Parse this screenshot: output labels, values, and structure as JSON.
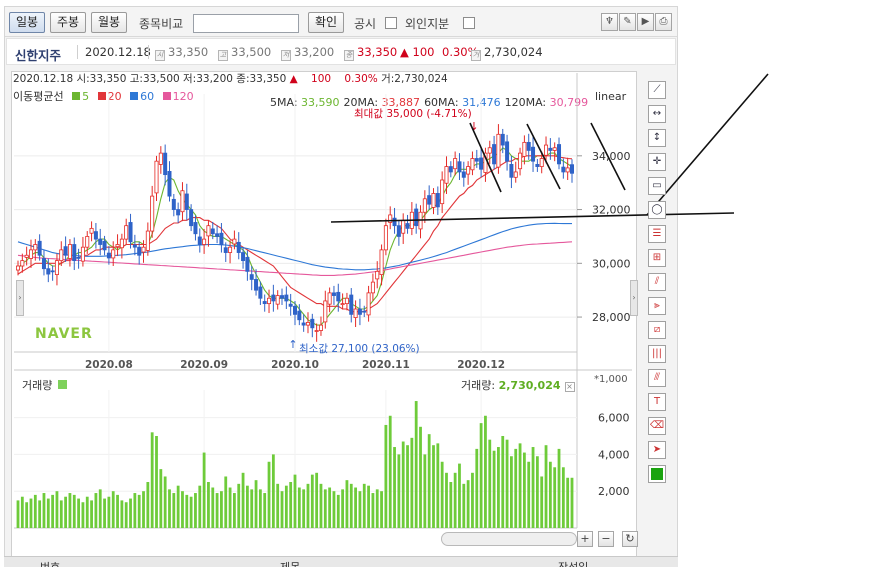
{
  "toolbar": {
    "periods": [
      "일봉",
      "주봉",
      "월봉"
    ],
    "compare_label": "종목비교",
    "compare_placeholder": "",
    "confirm_label": "확인",
    "disclosure_label": "공시",
    "foreign_label": "외인지분"
  },
  "stock": {
    "name": "신한지주",
    "date": "2020.12.18",
    "open": "33,350",
    "high": "33,500",
    "low": "33,200",
    "close": "33,350",
    "change": "▲ 100",
    "change_pct": "0.30%",
    "volume": "2,730,024",
    "icon_open": "시",
    "icon_high": "고",
    "icon_low": "저",
    "icon_close": "종",
    "icon_volume": "거"
  },
  "chart_head": {
    "line1_date": "2020.12.18",
    "line1_open": " 시:33,350",
    "line1_high": " 고:33,500",
    "line1_low": " 저:33,200",
    "line1_close": " 종:33,350",
    "line1_arrow": "▲",
    "line1_change": "100",
    "line1_pct": "0.30%",
    "line1_vol": " 거:2,730,024",
    "ma_title": "이동평균선",
    "ma_items": [
      "5",
      "20",
      "60",
      "120"
    ],
    "ma_values": [
      "5MA: 33,590",
      "20MA: 33,887",
      "60MA: 31,476",
      "120MA: 30,799"
    ],
    "scale": "linear",
    "max_label": "최대값 35,000 (-4.71%)",
    "min_label": "최소값 27,100 (23.06%)",
    "watermark": "NAVER"
  },
  "colors": {
    "ma5": "#6cb630",
    "ma20": "#e1363a",
    "ma60": "#2e78d6",
    "ma120": "#e5589c",
    "up": "#e52a26",
    "down": "#2f63c8",
    "volume": "#6ecb3a"
  },
  "volume_panel": {
    "title": "거래량",
    "right_label": "거래량:",
    "right_value": "2,730,024",
    "unit": "*1,000"
  },
  "bottom_header": {
    "left": "번호",
    "mid": "제목",
    "right": "작성일"
  },
  "chart_data": {
    "type": "line",
    "x_ticks": [
      "2020.08",
      "2020.09",
      "2020.10",
      "2020.11",
      "2020.12"
    ],
    "price_axis_ticks": [
      28000,
      30000,
      32000,
      34000
    ],
    "price_ylim": [
      26700,
      36300
    ],
    "volume_axis_ticks": [
      2000,
      4000,
      6000
    ],
    "volume_ylim": [
      0,
      7500
    ],
    "ohlc_close": [
      29900,
      30100,
      30300,
      30500,
      30700,
      30300,
      29800,
      29600,
      29700,
      30100,
      30500,
      30300,
      30700,
      30100,
      30200,
      30600,
      31000,
      31300,
      30900,
      30700,
      30500,
      30200,
      30500,
      30700,
      30900,
      31400,
      30800,
      30600,
      30300,
      30600,
      31200,
      32500,
      33800,
      34100,
      33300,
      32500,
      32000,
      31800,
      32700,
      32000,
      31400,
      31100,
      30700,
      30900,
      31400,
      31100,
      31000,
      30700,
      30400,
      30600,
      30900,
      30400,
      30100,
      29700,
      29400,
      29000,
      28700,
      28500,
      28700,
      28600,
      28800,
      28700,
      28600,
      28400,
      28100,
      27900,
      27700,
      27800,
      27600,
      27500,
      27700,
      28600,
      28900,
      28800,
      28600,
      28500,
      28700,
      28100,
      28300,
      28100,
      28200,
      28900,
      29300,
      29700,
      30500,
      31400,
      31800,
      31400,
      31000,
      31600,
      31300,
      31900,
      31400,
      31900,
      32400,
      32200,
      32600,
      32100,
      33100,
      33600,
      33400,
      33900,
      33400,
      33200,
      33600,
      33900,
      33800,
      33500,
      34100,
      34300,
      33700,
      34800,
      34400,
      33800,
      33200,
      33400,
      34100,
      34500,
      34200,
      33800,
      33600,
      33900,
      34400,
      34200,
      34300,
      33700,
      33400,
      33550,
      33350
    ],
    "ma_series": [
      {
        "name": "5",
        "values": [
          29800,
          30000,
          30100,
          30300,
          30400,
          30400,
          30200,
          30000,
          29900,
          29900,
          30000,
          30100,
          30300,
          30300,
          30400,
          30400,
          30500,
          30600,
          30800,
          30900,
          30900,
          30700,
          30600,
          30500,
          30600,
          30700,
          30700,
          30800,
          30800,
          30700,
          30700,
          31100,
          31700,
          32400,
          33000,
          33200,
          33100,
          32700,
          32400,
          32200,
          32000,
          31800,
          31400,
          31200,
          31100,
          31000,
          31000,
          31000,
          30900,
          30800,
          30700,
          30600,
          30500,
          30300,
          29900,
          29600,
          29300,
          29000,
          28800,
          28700,
          28700,
          28700,
          28700,
          28600,
          28500,
          28300,
          28100,
          27900,
          27800,
          27700,
          27700,
          27900,
          28100,
          28300,
          28500,
          28700,
          28700,
          28500,
          28400,
          28300,
          28300,
          28400,
          28600,
          28800,
          29300,
          29900,
          30500,
          30900,
          31200,
          31400,
          31400,
          31400,
          31500,
          31600,
          31800,
          32000,
          32100,
          32200,
          32500,
          32800,
          33000,
          33300,
          33500,
          33500,
          33500,
          33600,
          33700,
          33700,
          33800,
          33900,
          34000,
          34100,
          34300,
          34200,
          34000,
          33900,
          33800,
          33800,
          33800,
          33900,
          34000,
          34000,
          34000,
          34100,
          34100,
          33900,
          33800,
          33700,
          33590
        ]
      },
      {
        "name": "20",
        "values": [
          29600,
          29700,
          29800,
          29900,
          30000,
          30000,
          30000,
          30000,
          30000,
          30000,
          30000,
          30100,
          30100,
          30200,
          30200,
          30300,
          30300,
          30400,
          30500,
          30500,
          30600,
          30600,
          30600,
          30600,
          30600,
          30700,
          30700,
          30700,
          30700,
          30700,
          30700,
          30800,
          30900,
          31100,
          31300,
          31400,
          31500,
          31500,
          31600,
          31600,
          31700,
          31700,
          31700,
          31600,
          31600,
          31500,
          31400,
          31300,
          31100,
          30900,
          30800,
          30700,
          30600,
          30500,
          30400,
          30300,
          30200,
          30100,
          30000,
          29900,
          29700,
          29500,
          29300,
          29100,
          29000,
          28900,
          28800,
          28700,
          28600,
          28500,
          28500,
          28400,
          28400,
          28400,
          28400,
          28300,
          28300,
          28200,
          28200,
          28200,
          28200,
          28300,
          28400,
          28500,
          28700,
          28900,
          29100,
          29300,
          29500,
          29700,
          29900,
          30100,
          30300,
          30500,
          30700,
          30900,
          31200,
          31400,
          31700,
          31900,
          32100,
          32300,
          32500,
          32600,
          32800,
          32900,
          33100,
          33200,
          33300,
          33400,
          33500,
          33600,
          33700,
          33800,
          33800,
          33900,
          33900,
          34000,
          34000,
          34000,
          34000,
          34000,
          34000,
          34000,
          34000,
          33950,
          33930,
          33900,
          33887
        ]
      },
      {
        "name": "60",
        "values": [
          30800,
          30750,
          30700,
          30650,
          30600,
          30550,
          30500,
          30450,
          30400,
          30370,
          30340,
          30320,
          30300,
          30290,
          30280,
          30270,
          30260,
          30260,
          30260,
          30260,
          30270,
          30280,
          30290,
          30300,
          30310,
          30320,
          30340,
          30360,
          30380,
          30400,
          30420,
          30450,
          30480,
          30510,
          30540,
          30560,
          30580,
          30600,
          30620,
          30640,
          30660,
          30670,
          30680,
          30690,
          30700,
          30700,
          30700,
          30690,
          30680,
          30660,
          30640,
          30610,
          30580,
          30550,
          30510,
          30470,
          30430,
          30390,
          30350,
          30310,
          30270,
          30230,
          30190,
          30150,
          30110,
          30070,
          30030,
          29990,
          29950,
          29920,
          29890,
          29860,
          29840,
          29820,
          29800,
          29790,
          29780,
          29770,
          29760,
          29760,
          29760,
          29770,
          29780,
          29790,
          29810,
          29830,
          29860,
          29890,
          29920,
          29960,
          30000,
          30040,
          30080,
          30120,
          30160,
          30200,
          30250,
          30300,
          30350,
          30400,
          30460,
          30520,
          30580,
          30640,
          30700,
          30760,
          30820,
          30880,
          30940,
          31000,
          31060,
          31120,
          31180,
          31230,
          31280,
          31320,
          31360,
          31390,
          31420,
          31440,
          31460,
          31470,
          31480,
          31485,
          31490,
          31480,
          31478,
          31477,
          31476
        ]
      },
      {
        "name": "120",
        "values": [
          30300,
          30280,
          30260,
          30240,
          30220,
          30200,
          30190,
          30180,
          30170,
          30160,
          30150,
          30140,
          30130,
          30120,
          30110,
          30100,
          30090,
          30080,
          30070,
          30060,
          30050,
          30040,
          30030,
          30020,
          30010,
          30000,
          29990,
          29980,
          29970,
          29960,
          29950,
          29940,
          29930,
          29920,
          29910,
          29900,
          29890,
          29880,
          29870,
          29860,
          29850,
          29840,
          29830,
          29820,
          29810,
          29800,
          29790,
          29780,
          29770,
          29760,
          29750,
          29740,
          29730,
          29720,
          29710,
          29700,
          29690,
          29680,
          29670,
          29660,
          29650,
          29640,
          29630,
          29620,
          29610,
          29600,
          29590,
          29580,
          29570,
          29560,
          29550,
          29550,
          29550,
          29550,
          29560,
          29570,
          29580,
          29590,
          29600,
          29620,
          29640,
          29660,
          29680,
          29700,
          29730,
          29760,
          29790,
          29820,
          29850,
          29880,
          29910,
          29940,
          29970,
          30000,
          30030,
          30060,
          30090,
          30120,
          30150,
          30180,
          30210,
          30240,
          30270,
          30300,
          30330,
          30360,
          30390,
          30420,
          30450,
          30480,
          30510,
          30540,
          30570,
          30600,
          30620,
          30640,
          30660,
          30680,
          30700,
          30710,
          30720,
          30730,
          30740,
          30750,
          30760,
          30770,
          30780,
          30790,
          30799
        ]
      }
    ],
    "volume_values": [
      1500,
      1700,
      1400,
      1600,
      1800,
      1500,
      1900,
      1600,
      1800,
      2000,
      1500,
      1700,
      1900,
      1800,
      1600,
      1400,
      1700,
      1500,
      1900,
      2100,
      1600,
      1700,
      2000,
      1800,
      1500,
      1400,
      1600,
      1900,
      1800,
      2000,
      2500,
      5200,
      5000,
      3200,
      2800,
      2100,
      1900,
      2300,
      2000,
      1800,
      1700,
      1900,
      2300,
      4100,
      2500,
      2200,
      1900,
      2000,
      2800,
      2200,
      1900,
      2400,
      3000,
      2300,
      2100,
      2600,
      2100,
      1900,
      3600,
      4000,
      2400,
      2000,
      2300,
      2500,
      2900,
      2200,
      2100,
      2400,
      2900,
      3000,
      2400,
      2100,
      2200,
      2000,
      1800,
      2100,
      2600,
      2400,
      2200,
      2000,
      2400,
      2300,
      1900,
      2100,
      2000,
      5600,
      6100,
      4400,
      4000,
      4700,
      4500,
      4900,
      6900,
      5500,
      4000,
      5100,
      4500,
      4600,
      3600,
      3000,
      2500,
      3000,
      3500,
      2400,
      2600,
      3000,
      4300,
      5700,
      6100,
      4800,
      4200,
      4400,
      5000,
      4800,
      3900,
      4300,
      4600,
      4100,
      3600,
      4400,
      3900,
      2800,
      4500,
      3600,
      3300,
      4300,
      3300,
      2730,
      2730
    ],
    "annotations": [
      "최대값 35,000 (-4.71%)",
      "최소값 27,100 (23.06%)"
    ]
  },
  "tools": [
    "line-tool-icon",
    "horizontal-line-tool-icon",
    "vertical-line-tool-icon",
    "crosshair-tool-icon",
    "rectangle-tool-icon",
    "circle-tool-icon",
    "fibonacci-retracement-icon",
    "fibonacci-fan-icon",
    "speed-line-icon",
    "gann-fan-icon",
    "parallel-line-icon",
    "fibonacci-time-zone-icon",
    "channel-tool-icon",
    "text-tool-icon",
    "eraser-tool-icon",
    "pointer-tool-icon",
    "color-picker-icon"
  ]
}
